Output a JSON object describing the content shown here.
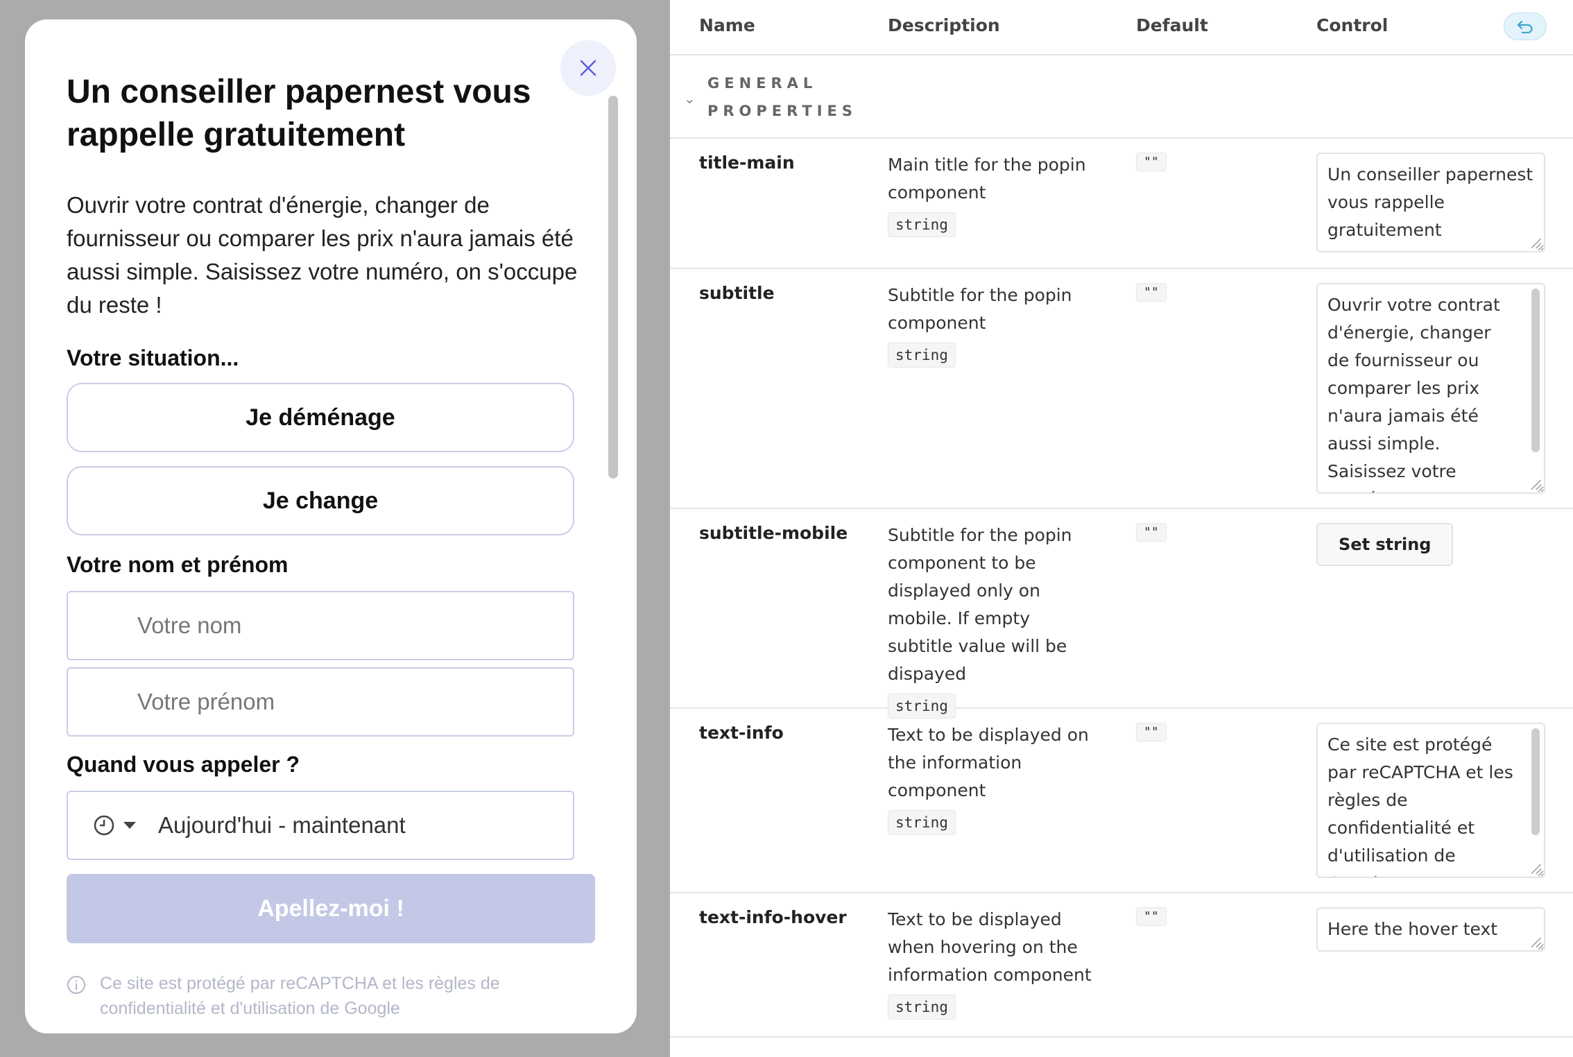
{
  "popin": {
    "title": "Un conseiller papernest vous rappelle gratuitement",
    "subtitle": "Ouvrir votre contrat d'énergie, changer de fournisseur ou comparer les prix n'aura jamais été aussi simple. Saisissez votre numéro, on s'occupe du reste !",
    "situation_label": "Votre situation...",
    "situation_options": [
      "Je déménage",
      "Je change"
    ],
    "name_label": "Votre nom et prénom",
    "last_name_placeholder": "Votre nom",
    "first_name_placeholder": "Votre prénom",
    "when_label": "Quand vous appeler ?",
    "when_value": "Aujourd'hui - maintenant",
    "submit_label": "Apellez-moi !",
    "recaptcha_text": "Ce site est protégé par reCAPTCHA et les règles de confidentialité et d'utilisation de Google"
  },
  "args_table": {
    "headers": {
      "name": "Name",
      "description": "Description",
      "default": "Default",
      "control": "Control"
    },
    "group_label": "GENERAL PROPERTIES",
    "rows": [
      {
        "name": "title-main",
        "description": "Main title for the popin component",
        "type": "string",
        "default": "\"\"",
        "control_value": "Un conseiller papernest vous rappelle gratuitement"
      },
      {
        "name": "subtitle",
        "description": "Subtitle for the popin component",
        "type": "string",
        "default": "\"\"",
        "control_value": "Ouvrir votre contrat d'énergie, changer de fournisseur ou comparer les prix n'aura jamais été aussi simple. Saisissez votre numéro, on s'occupe du reste !"
      },
      {
        "name": "subtitle-mobile",
        "description": "Subtitle for the popin component to be displayed only on mobile. If empty subtitle value will be dispayed",
        "type": "string",
        "default": "\"\"",
        "control_button": "Set string"
      },
      {
        "name": "text-info",
        "description": "Text to be displayed on the information component",
        "type": "string",
        "default": "\"\"",
        "control_value": "Ce site est protégé par reCAPTCHA et les règles de confidentialité et d'utilisation de Google"
      },
      {
        "name": "text-info-hover",
        "description": "Text to be displayed when hovering on the information component",
        "type": "string",
        "default": "\"\"",
        "control_value": "Here the hover text"
      }
    ]
  },
  "colors": {
    "accent": "#5b5fd6",
    "submit_disabled": "#c3c8e6",
    "reset_accent": "#3aa7c9"
  }
}
